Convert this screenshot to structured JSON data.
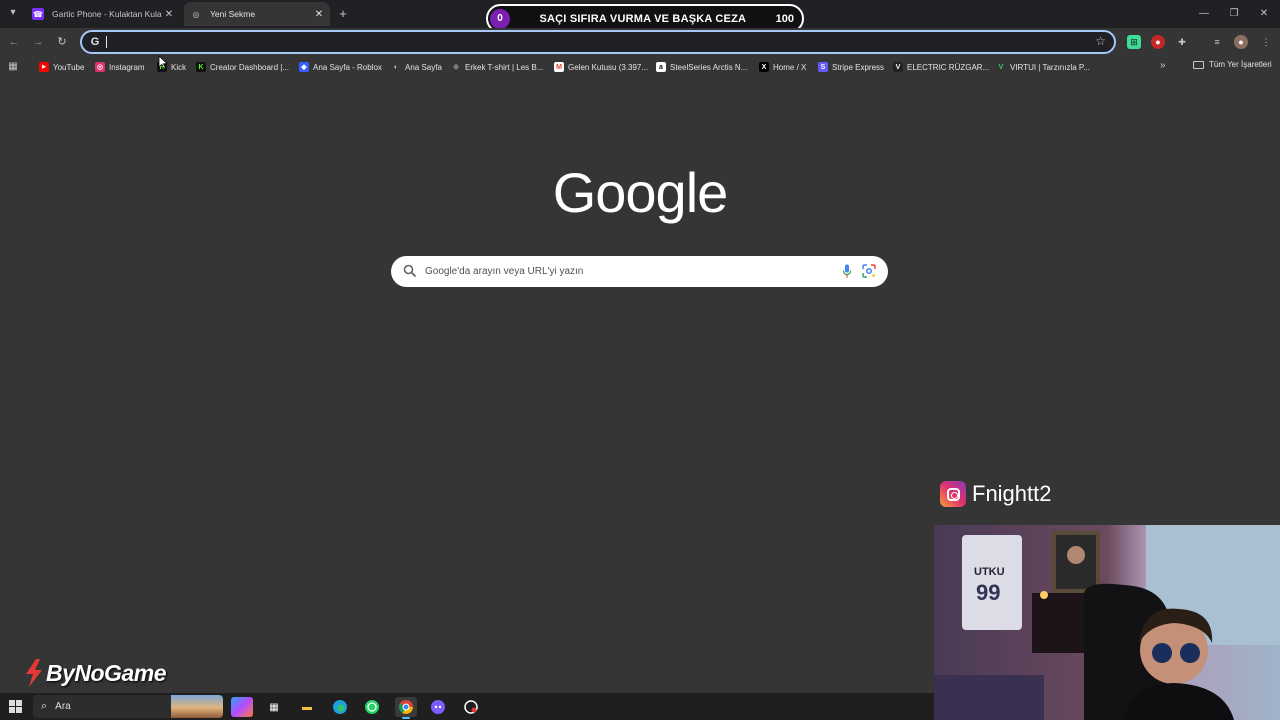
{
  "browser": {
    "tabs": [
      {
        "label": "Gartic Phone - Kulaktan Kulağa",
        "active": false,
        "favicon": "gartic-phone-icon"
      },
      {
        "label": "Yeni Sekme",
        "active": true,
        "favicon": "chrome-newtab-icon"
      }
    ],
    "omnibox": {
      "value": "",
      "icon": "google-g-icon"
    },
    "bookmarks": [
      {
        "label": "YouTube",
        "icon": "youtube-icon",
        "color": "#ff0000"
      },
      {
        "label": "Instagram",
        "icon": "instagram-icon",
        "color": "#e1306c"
      },
      {
        "label": "Kick",
        "icon": "kick-icon",
        "color": "#53fc18"
      },
      {
        "label": "Creator Dashboard |...",
        "icon": "kick-icon",
        "color": "#53fc18"
      },
      {
        "label": "Ana Sayfa - Roblox",
        "icon": "roblox-icon",
        "color": "#335fff"
      },
      {
        "label": "Ana Sayfa",
        "icon": "steam-icon",
        "color": "#c4c7c5"
      },
      {
        "label": "Erkek T-shirt | Les B...",
        "icon": "globe-icon",
        "color": "#8e918f"
      },
      {
        "label": "Gelen Kutusu (3.397...",
        "icon": "gmail-icon",
        "color": "#ea4335"
      },
      {
        "label": "SteelSeries Arctis N...",
        "icon": "amazon-icon",
        "color": "#ffffff"
      },
      {
        "label": "Home / X",
        "icon": "x-icon",
        "color": "#000000"
      },
      {
        "label": "Stripe Express",
        "icon": "stripe-icon",
        "color": "#635bff"
      },
      {
        "label": "ELECTRIC RÜZGAR...",
        "icon": "electric-icon",
        "color": "#222222"
      },
      {
        "label": "VIRTUI | Tarzınızla P...",
        "icon": "virtui-icon",
        "color": "#2ecc71"
      }
    ],
    "all_bookmarks_label": "Tüm Yer İşaretleri"
  },
  "overlay": {
    "left_value": "0",
    "text": "SAÇI SIFIRA VURMA VE BAŞKA CEZA",
    "right_value": "100"
  },
  "google": {
    "logo": "Google",
    "search_placeholder": "Google'da arayın veya URL'yi yazın"
  },
  "stream": {
    "instagram_handle": "Fnightt2",
    "brand": "ByNoGame"
  },
  "taskbar": {
    "search_label": "Ara",
    "apps": [
      "copilot-icon",
      "store-icon",
      "file-explorer-icon",
      "edge-icon",
      "whatsapp-icon",
      "chrome-icon",
      "discord-icon",
      "steelseries-icon"
    ]
  }
}
